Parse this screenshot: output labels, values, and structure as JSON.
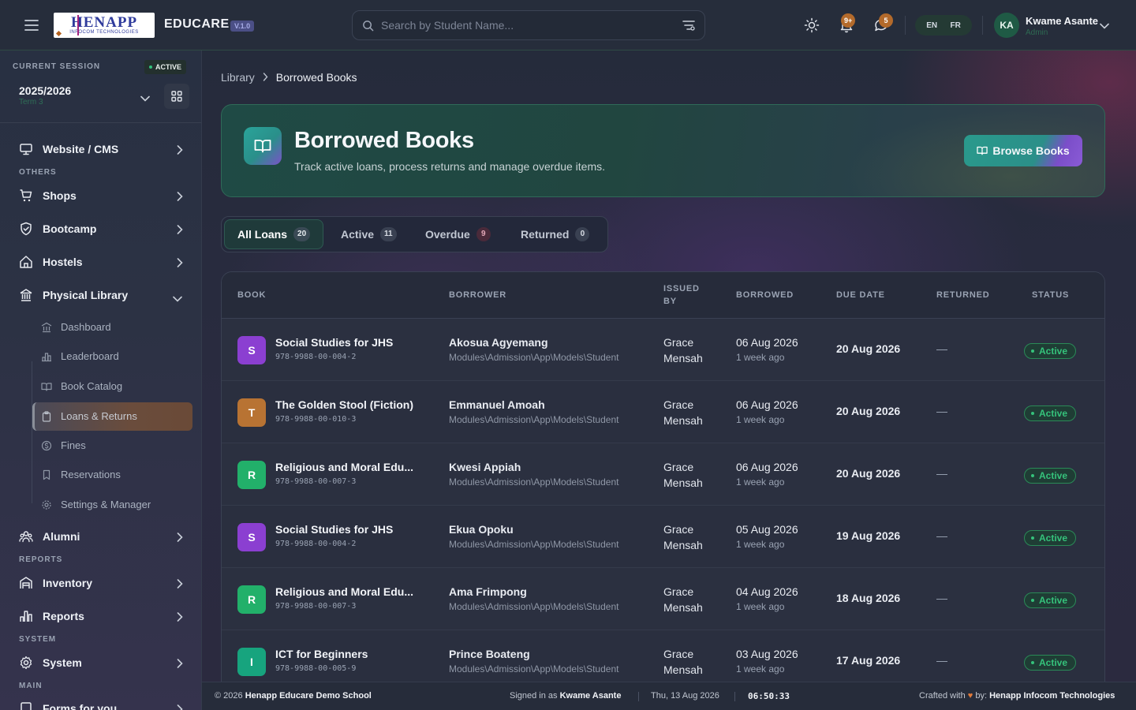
{
  "header": {
    "logo_main": "HENAPP",
    "logo_sub": "INFOCOM TECHNOLOGIES",
    "brand": "EDUCARE",
    "version": "V.1.0",
    "search_placeholder": "Search by Student Name...",
    "notifications_count": "9+",
    "messages_count": "5",
    "lang_en": "EN",
    "lang_fr": "FR",
    "user_initials": "KA",
    "user_name": "Kwame Asante",
    "user_role": "Admin"
  },
  "sidebar": {
    "session_label": "CURRENT SESSION",
    "session_status": "ACTIVE",
    "session_year": "2025/2026",
    "session_term": "Term 3",
    "nav": [
      {
        "label": "Website / CMS",
        "icon": "monitor-icon"
      },
      {
        "section": "OTHERS"
      },
      {
        "label": "Shops",
        "icon": "cart-icon"
      },
      {
        "label": "Bootcamp",
        "icon": "shield-icon"
      },
      {
        "label": "Hostels",
        "icon": "home-icon"
      },
      {
        "label": "Physical Library",
        "icon": "library-icon"
      },
      {
        "label": "Alumni",
        "icon": "users-icon"
      },
      {
        "section": "REPORTS"
      },
      {
        "label": "Inventory",
        "icon": "warehouse-icon"
      },
      {
        "label": "Reports",
        "icon": "bar-chart-icon"
      },
      {
        "section": "SYSTEM"
      },
      {
        "label": "System",
        "icon": "gear-icon"
      },
      {
        "section": "MAIN"
      },
      {
        "label": "Forms for you",
        "icon": "form-icon"
      }
    ],
    "library_sub": [
      "Dashboard",
      "Leaderboard",
      "Book Catalog",
      "Loans & Returns",
      "Fines",
      "Reservations",
      "Settings & Manager"
    ]
  },
  "breadcrumb": {
    "parent": "Library",
    "current": "Borrowed Books"
  },
  "hero": {
    "title": "Borrowed Books",
    "subtitle": "Track active loans, process returns and manage overdue items.",
    "button": "Browse Books"
  },
  "tabs": [
    {
      "label": "All Loans",
      "count": "20"
    },
    {
      "label": "Active",
      "count": "11"
    },
    {
      "label": "Overdue",
      "count": "9"
    },
    {
      "label": "Returned",
      "count": "0"
    }
  ],
  "table": {
    "headers": [
      "BOOK",
      "BORROWER",
      "ISSUED",
      "BY",
      "BORROWED",
      "DUE DATE",
      "RETURNED",
      "STATUS"
    ],
    "rows": [
      {
        "initial": "S",
        "color": "#8b3fd1",
        "title": "Social Studies for JHS",
        "isbn": "978-9988-00-004-2",
        "borrower": "Akosua Agyemang",
        "type": "Modules\\Admission\\App\\Models\\Student",
        "issuer_first": "Grace",
        "issuer_last": "Mensah",
        "borrowed": "06 Aug 2026",
        "ago": "1 week ago",
        "due": "20 Aug 2026",
        "returned": "—",
        "status": "Active"
      },
      {
        "initial": "T",
        "color": "#b87333",
        "title": "The Golden Stool (Fiction)",
        "isbn": "978-9988-00-010-3",
        "borrower": "Emmanuel Amoah",
        "type": "Modules\\Admission\\App\\Models\\Student",
        "issuer_first": "Grace",
        "issuer_last": "Mensah",
        "borrowed": "06 Aug 2026",
        "ago": "1 week ago",
        "due": "20 Aug 2026",
        "returned": "—",
        "status": "Active"
      },
      {
        "initial": "R",
        "color": "#22b06a",
        "title": "Religious and Moral Edu...",
        "isbn": "978-9988-00-007-3",
        "borrower": "Kwesi Appiah",
        "type": "Modules\\Admission\\App\\Models\\Student",
        "issuer_first": "Grace",
        "issuer_last": "Mensah",
        "borrowed": "06 Aug 2026",
        "ago": "1 week ago",
        "due": "20 Aug 2026",
        "returned": "—",
        "status": "Active"
      },
      {
        "initial": "S",
        "color": "#8b3fd1",
        "title": "Social Studies for JHS",
        "isbn": "978-9988-00-004-2",
        "borrower": "Ekua Opoku",
        "type": "Modules\\Admission\\App\\Models\\Student",
        "issuer_first": "Grace",
        "issuer_last": "Mensah",
        "borrowed": "05 Aug 2026",
        "ago": "1 week ago",
        "due": "19 Aug 2026",
        "returned": "—",
        "status": "Active"
      },
      {
        "initial": "R",
        "color": "#22b06a",
        "title": "Religious and Moral Edu...",
        "isbn": "978-9988-00-007-3",
        "borrower": "Ama Frimpong",
        "type": "Modules\\Admission\\App\\Models\\Student",
        "issuer_first": "Grace",
        "issuer_last": "Mensah",
        "borrowed": "04 Aug 2026",
        "ago": "1 week ago",
        "due": "18 Aug 2026",
        "returned": "—",
        "status": "Active"
      },
      {
        "initial": "I",
        "color": "#17a47e",
        "title": "ICT for Beginners",
        "isbn": "978-9988-00-005-9",
        "borrower": "Prince Boateng",
        "type": "Modules\\Admission\\App\\Models\\Student",
        "issuer_first": "Grace",
        "issuer_last": "Mensah",
        "borrowed": "03 Aug 2026",
        "ago": "1 week ago",
        "due": "17 Aug 2026",
        "returned": "—",
        "status": "Active"
      }
    ]
  },
  "footer": {
    "copyright_prefix": "© 2026",
    "school": "Henapp Educare Demo School",
    "signed_prefix": "Signed in as",
    "signed_user": "Kwame Asante",
    "date": "Thu, 13 Aug 2026",
    "time": "06:50:33",
    "crafted_prefix": "Crafted with",
    "crafted_by": "by:",
    "company": "Henapp Infocom Technologies"
  }
}
